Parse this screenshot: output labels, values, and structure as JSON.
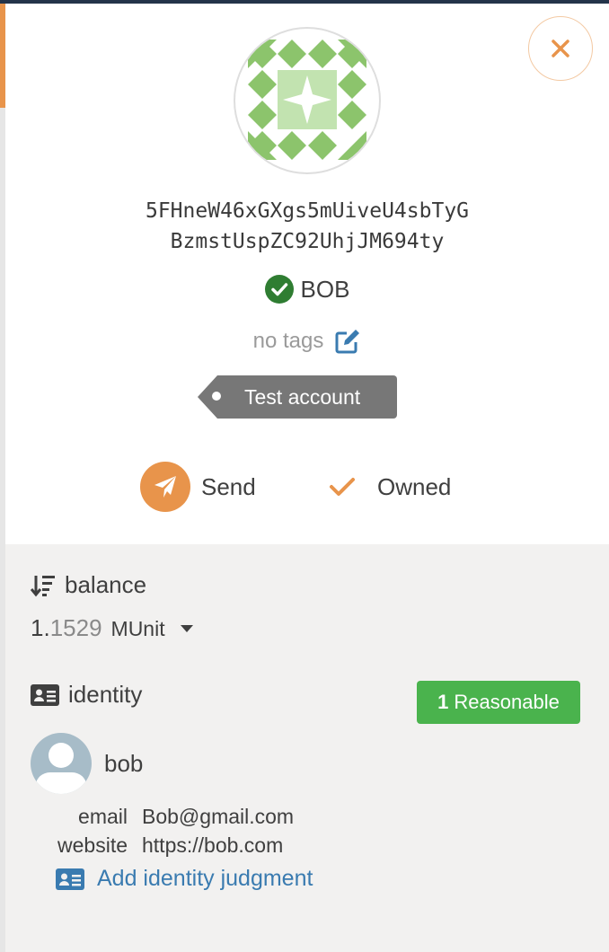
{
  "account": {
    "address_line1": "5FHneW46xGXgs5mUiveU4sbTyG",
    "address_line2": "BzmstUspZC92UhjJM694ty",
    "name": "BOB",
    "tags_placeholder": "no tags",
    "tag_label": "Test account"
  },
  "actions": {
    "send_label": "Send",
    "owned_label": "Owned"
  },
  "balance": {
    "title": "balance",
    "value_int": "1.",
    "value_dec": "1529",
    "unit": "MUnit"
  },
  "identity": {
    "title": "identity",
    "judgement_count": "1",
    "judgement_label": "Reasonable",
    "display_name": "bob",
    "fields": [
      {
        "label": "email",
        "value": "Bob@gmail.com"
      },
      {
        "label": "website",
        "value": "https://bob.com"
      }
    ],
    "add_judgment_label": "Add identity judgment"
  },
  "colors": {
    "accent": "#e8944b",
    "success": "#4ab34d",
    "verified": "#2f7d32",
    "link": "#3a7bb0",
    "tag_bg": "#777777",
    "identicon_green": "#8cc46c",
    "identicon_light": "#c2e3b0"
  },
  "icons": {
    "close": "close-icon",
    "edit": "edit-icon",
    "verified": "check-circle-icon",
    "send": "paper-plane-icon",
    "owned": "check-icon",
    "balance": "sort-amount-icon",
    "identity": "id-card-icon",
    "caret": "caret-down-icon"
  }
}
